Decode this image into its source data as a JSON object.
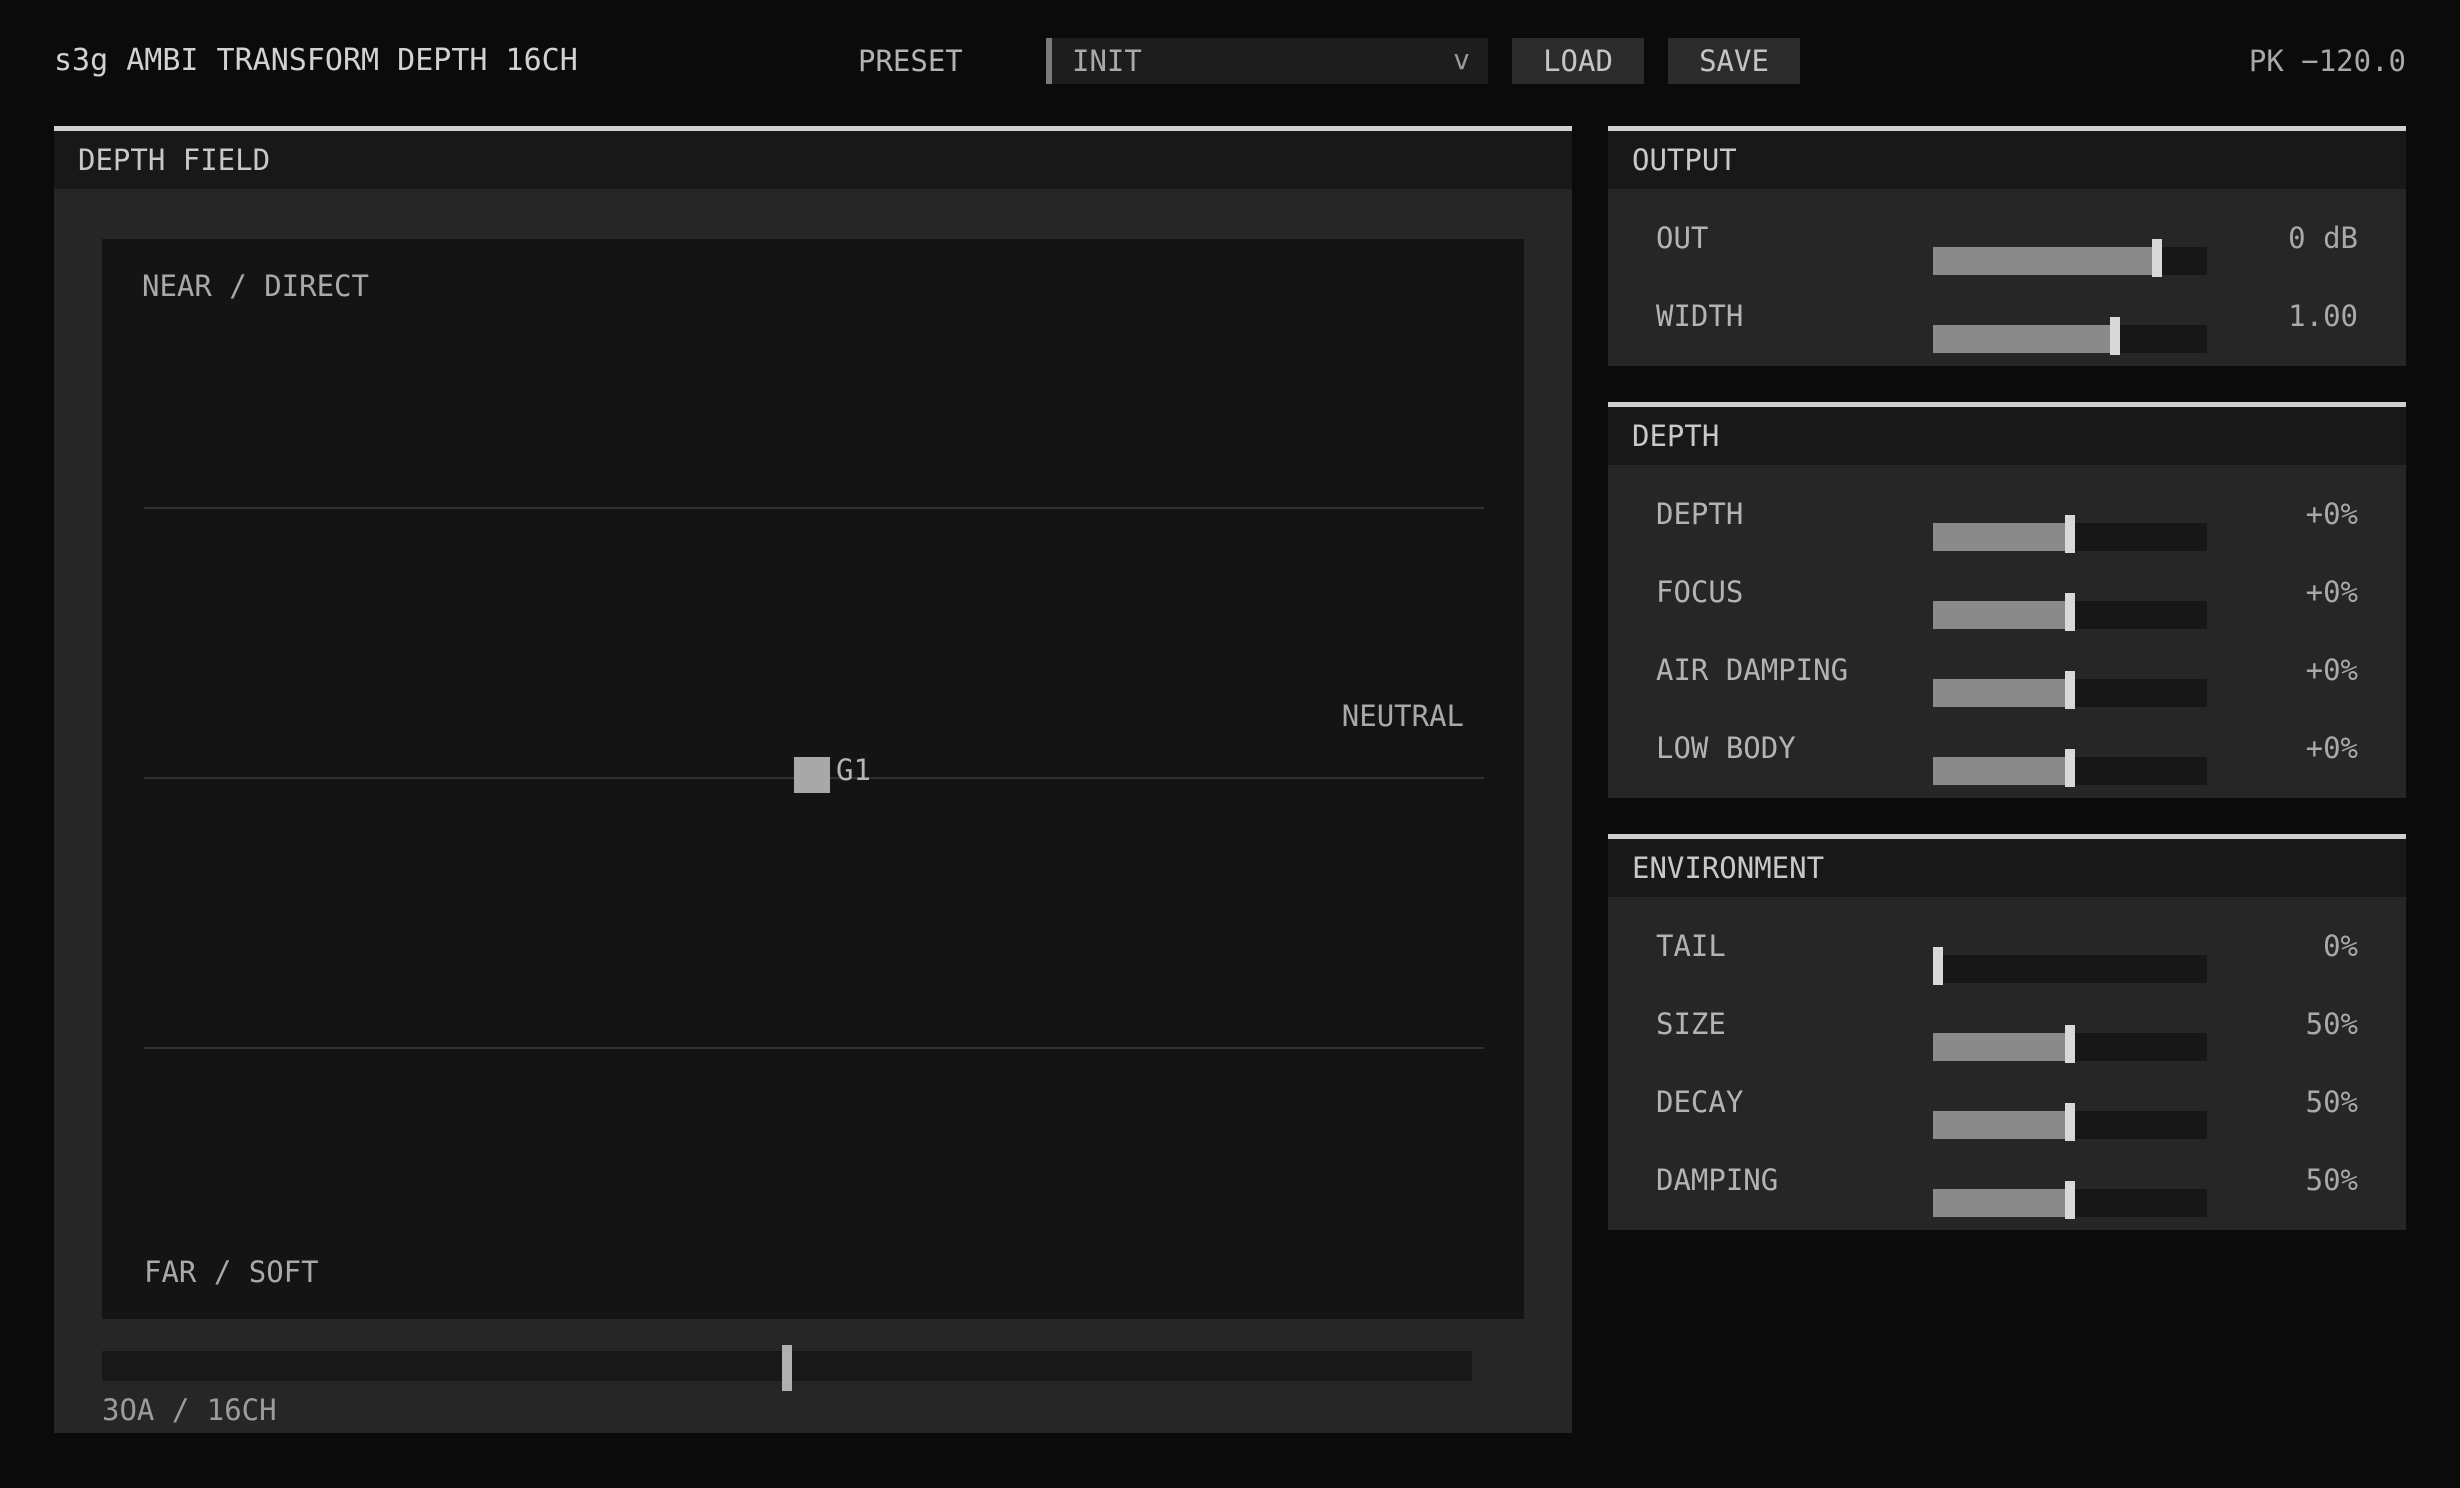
{
  "header": {
    "title": "s3g AMBI TRANSFORM DEPTH 16CH",
    "preset_label": "PRESET",
    "preset_value": "INIT",
    "preset_chevron": "v",
    "load_label": "LOAD",
    "save_label": "SAVE",
    "peak_readout": "PK −120.0"
  },
  "depth_field": {
    "title": "DEPTH FIELD",
    "near_label": "NEAR / DIRECT",
    "far_label": "FAR / SOFT",
    "neutral_label": "NEUTRAL",
    "node_label": "G1",
    "scroll_position": 0.5,
    "footer": "3OA / 16CH"
  },
  "output": {
    "title": "OUTPUT",
    "params": [
      {
        "name": "OUT",
        "value": "0 dB",
        "level": 0.83
      },
      {
        "name": "WIDTH",
        "value": "1.00",
        "level": 0.67
      }
    ]
  },
  "depth": {
    "title": "DEPTH",
    "params": [
      {
        "name": "DEPTH",
        "value": "+0%",
        "level": 0.5
      },
      {
        "name": "FOCUS",
        "value": "+0%",
        "level": 0.5
      },
      {
        "name": "AIR DAMPING",
        "value": "+0%",
        "level": 0.5
      },
      {
        "name": "LOW BODY",
        "value": "+0%",
        "level": 0.5
      }
    ]
  },
  "environment": {
    "title": "ENVIRONMENT",
    "params": [
      {
        "name": "TAIL",
        "value": "0%",
        "level": 0.0
      },
      {
        "name": "SIZE",
        "value": "50%",
        "level": 0.5
      },
      {
        "name": "DECAY",
        "value": "50%",
        "level": 0.5
      },
      {
        "name": "DAMPING",
        "value": "50%",
        "level": 0.5
      }
    ]
  }
}
